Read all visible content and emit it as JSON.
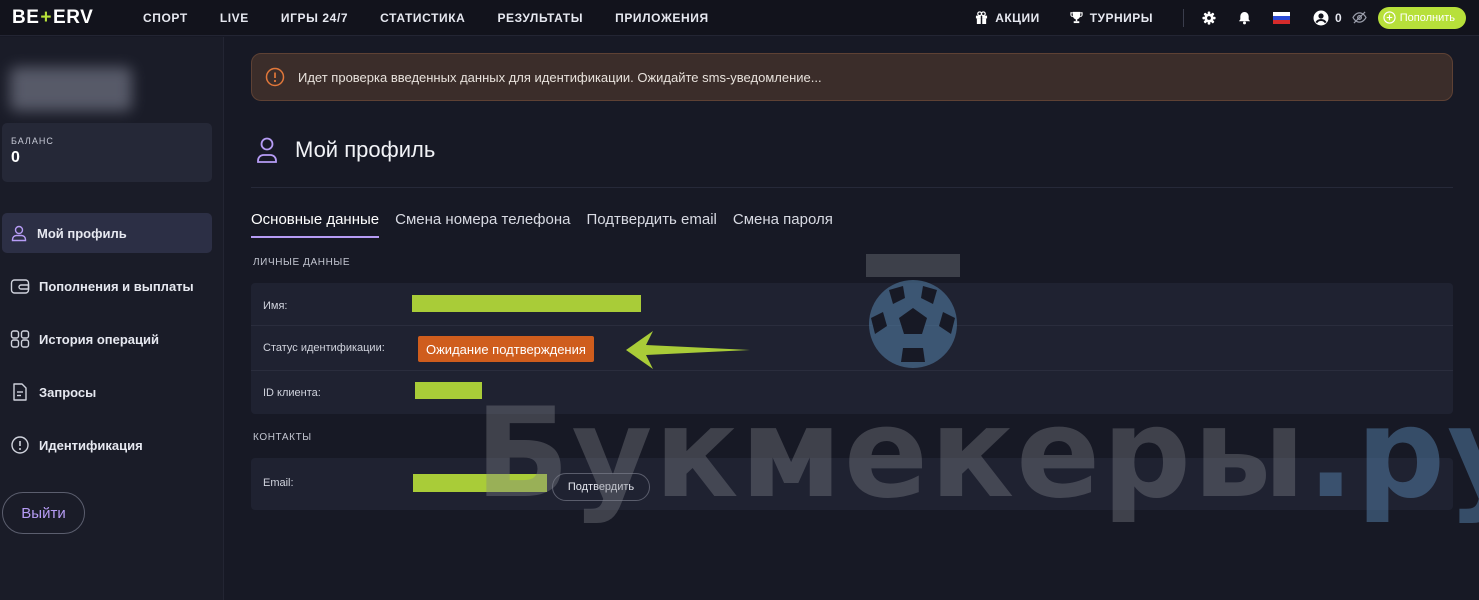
{
  "header": {
    "logo_left": "BE",
    "logo_plus": "+",
    "logo_right": "ERV",
    "nav": [
      "СПОРТ",
      "LIVE",
      "ИГРЫ 24/7",
      "СТАТИСТИКА",
      "РЕЗУЛЬТАТЫ",
      "ПРИЛОЖЕНИЯ"
    ],
    "promotions_label": "АКЦИИ",
    "tournaments_label": "ТУРНИРЫ",
    "account_balance": "0",
    "deposit_label": "Пополнить"
  },
  "sidebar": {
    "balance_label": "БАЛАНС",
    "balance_value": "0",
    "items": [
      {
        "label": "Мой профиль",
        "icon": "user-icon",
        "active": true
      },
      {
        "label": "Пополнения и выплаты",
        "icon": "wallet-icon",
        "active": false
      },
      {
        "label": "История операций",
        "icon": "grid-icon",
        "active": false
      },
      {
        "label": "Запросы",
        "icon": "document-icon",
        "active": false
      },
      {
        "label": "Идентификация",
        "icon": "info-icon",
        "active": false
      }
    ],
    "logout_label": "Выйти"
  },
  "alert": {
    "text": "Идет проверка введенных данных для идентификации. Ожидайте sms-уведомление..."
  },
  "page": {
    "title": "Мой профиль",
    "tabs": [
      "Основные данные",
      "Смена номера телефона",
      "Подтвердить email",
      "Смена пароля"
    ],
    "active_tab": "Основные данные"
  },
  "personal": {
    "section_label": "ЛИЧНЫЕ ДАННЫЕ",
    "name_label": "Имя:",
    "status_label": "Статус идентификации:",
    "status_value": "Ожидание подтверждения",
    "client_id_label": "ID клиента:"
  },
  "contacts": {
    "section_label": "КОНТАКТЫ",
    "email_label": "Email:",
    "confirm_label": "Подтвердить"
  },
  "watermark": {
    "text": "Букмекеры",
    "tld": ".ру"
  },
  "colors": {
    "accent_lime": "#b7e03a",
    "accent_purple": "#b69cf5",
    "status_orange": "#cf5d1d",
    "alert_bg": "#3b2d2a",
    "redaction": "#a9cc38"
  }
}
